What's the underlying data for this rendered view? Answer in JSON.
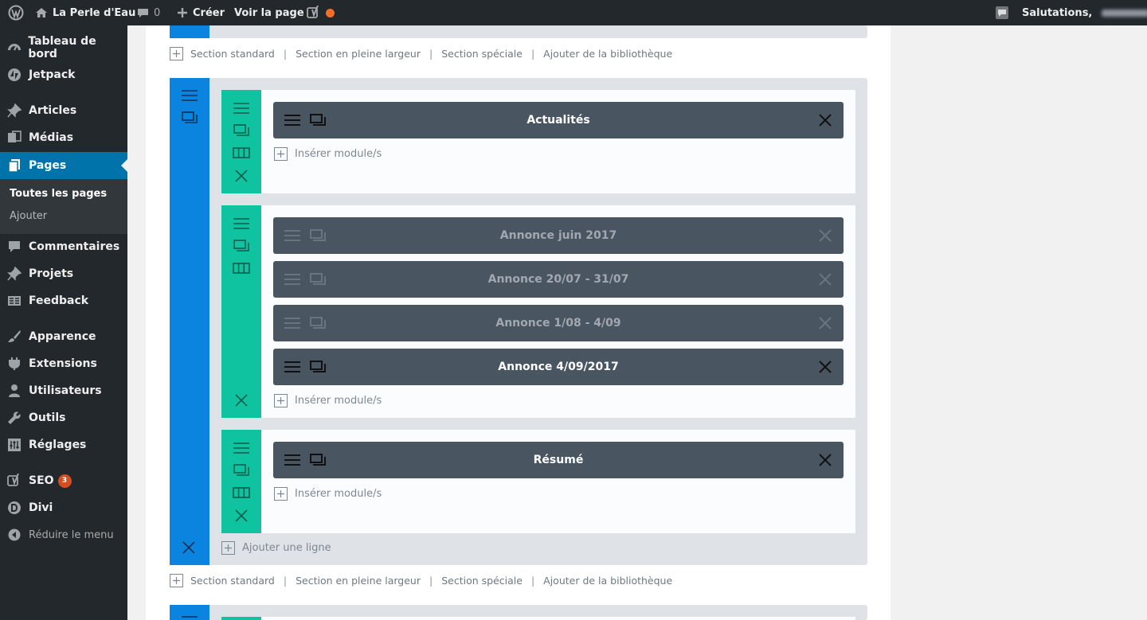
{
  "adminbar": {
    "site_name": "La Perle d'Eau",
    "comments_count": "0",
    "create_label": "Créer",
    "view_page_label": "Voir la page",
    "greeting": "Salutations,"
  },
  "sidebar": {
    "items": [
      {
        "label": "Tableau de bord",
        "icon": "dashboard-icon"
      },
      {
        "label": "Jetpack",
        "icon": "jetpack-icon"
      },
      {
        "label": "Articles",
        "icon": "pin-icon"
      },
      {
        "label": "Médias",
        "icon": "media-icon"
      },
      {
        "label": "Pages",
        "icon": "pages-icon"
      },
      {
        "label": "Commentaires",
        "icon": "comments-icon"
      },
      {
        "label": "Projets",
        "icon": "pin-icon"
      },
      {
        "label": "Feedback",
        "icon": "feedback-icon"
      },
      {
        "label": "Apparence",
        "icon": "brush-icon"
      },
      {
        "label": "Extensions",
        "icon": "plugin-icon"
      },
      {
        "label": "Utilisateurs",
        "icon": "users-icon"
      },
      {
        "label": "Outils",
        "icon": "wrench-icon"
      },
      {
        "label": "Réglages",
        "icon": "settings-icon"
      },
      {
        "label": "SEO",
        "icon": "yoast-icon",
        "badge": "3"
      },
      {
        "label": "Divi",
        "icon": "divi-icon"
      },
      {
        "label": "Réduire le menu",
        "icon": "collapse-icon"
      }
    ],
    "submenu": [
      "Toutes les pages",
      "Ajouter"
    ]
  },
  "builder": {
    "add_links": {
      "standard": "Section standard",
      "fullwidth": "Section en pleine largeur",
      "special": "Section spéciale",
      "library": "Ajouter de la bibliothèque"
    },
    "insert_module": "Insérer module/s",
    "add_row": "Ajouter une ligne",
    "rows": [
      {
        "modules": [
          {
            "title": "Actualités",
            "disabled": false
          }
        ]
      },
      {
        "modules": [
          {
            "title": "Annonce juin 2017",
            "disabled": true
          },
          {
            "title": "Annonce 20/07 - 31/07",
            "disabled": true
          },
          {
            "title": "Annonce 1/08 - 4/09",
            "disabled": true
          },
          {
            "title": "Annonce 4/09/2017",
            "disabled": false
          }
        ]
      },
      {
        "modules": [
          {
            "title": "Résumé",
            "disabled": false
          }
        ]
      }
    ]
  },
  "colors": {
    "section_handle": "#0b84e0",
    "row_handle": "#0fc3a1",
    "module_bg": "#4a5562",
    "admin_accent": "#0073aa"
  }
}
